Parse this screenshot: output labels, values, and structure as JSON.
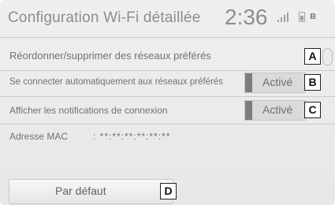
{
  "header": {
    "title": "Configuration Wi-Fi détaillée",
    "time": "2:36",
    "status_icons": [
      "signal-icon",
      "battery-icon",
      "bluetooth-icon"
    ]
  },
  "rows": [
    {
      "label": "Réordonner/supprimer des réseaux préférés",
      "callout": "A"
    },
    {
      "label": "Se connecter automatiquement aux réseaux préférés",
      "toggle": "Activé",
      "callout": "B"
    },
    {
      "label": "Afficher les notifications de connexion",
      "toggle": "Activé",
      "callout": "C"
    }
  ],
  "mac": {
    "label": "Adresse MAC",
    "value": ": **:**:**:**:**:**"
  },
  "default_button": {
    "label": "Par défaut",
    "callout": "D"
  },
  "colors": {
    "background": "#e9ebea",
    "text": "#6f7271",
    "toggle_knob": "#7b7e7d"
  }
}
